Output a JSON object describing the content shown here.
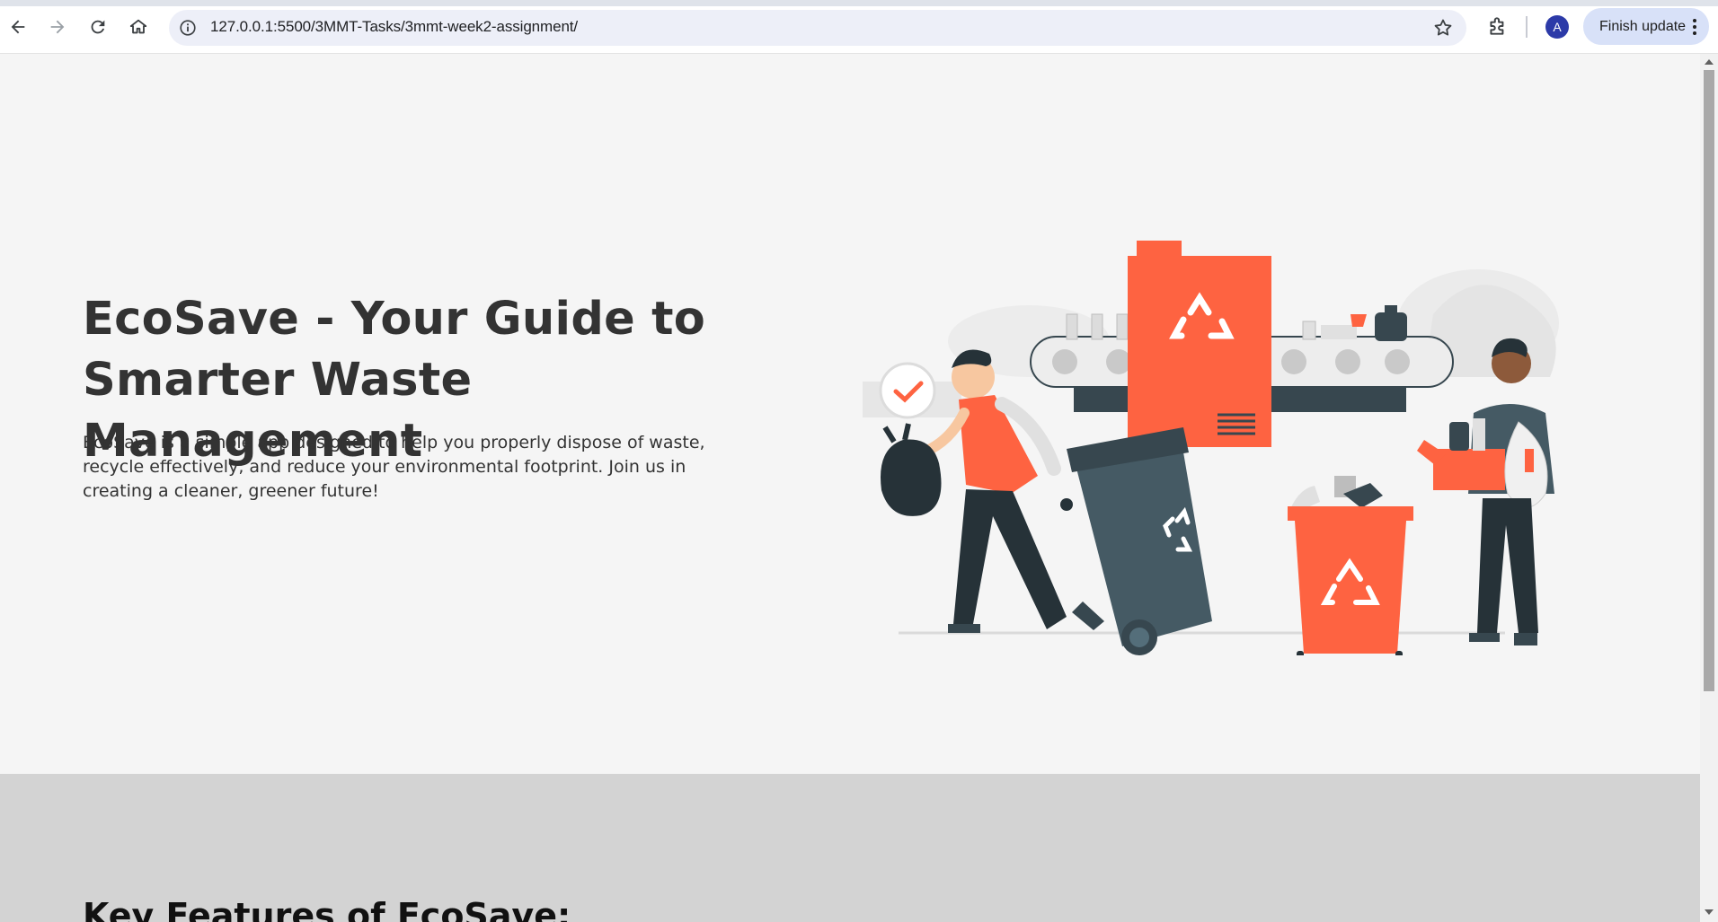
{
  "browser": {
    "url": "127.0.0.1:5500/3MMT-Tasks/3mmt-week2-assignment/",
    "profile_initial": "A",
    "finish_update_label": "Finish update",
    "icons": [
      "back-arrow-icon",
      "forward-arrow-icon",
      "reload-icon",
      "home-icon",
      "site-info-icon",
      "bookmark-star-icon",
      "extensions-puzzle-icon",
      "kebab-menu-icon"
    ]
  },
  "hero": {
    "title": "EcoSave - Your Guide to Smarter Waste Management",
    "description": "EcoSave is a simple app designed to help you properly dispose of waste, recycle effectively, and reduce your environmental footprint. Join us in creating a cleaner, greener future!",
    "illustration": "recycling-workers-illustration"
  },
  "features": {
    "heading": "Key Features of EcoSave:"
  },
  "colors": {
    "accent_orange": "#fe6341",
    "dark_slate": "#37474f",
    "page_bg": "#f5f5f5",
    "section_bg": "#d3d3d3"
  }
}
